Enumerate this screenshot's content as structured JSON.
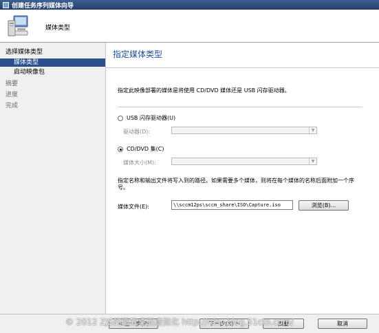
{
  "window": {
    "title": "创建任务序列媒体向导"
  },
  "header": {
    "title": "媒体类型"
  },
  "sidebar": {
    "items": [
      {
        "label": "选择媒体类型"
      },
      {
        "label": "媒体类型"
      },
      {
        "label": "启动映像包"
      },
      {
        "label": "摘要"
      },
      {
        "label": "进度"
      },
      {
        "label": "完成"
      }
    ]
  },
  "main": {
    "title": "指定媒体类型",
    "description": "指定此映像部署的媒体是将使用 CD/DVD 媒体还是 USB 闪存驱动器。",
    "usb_option": {
      "label": "USB 闪存驱动器(U)",
      "selected": false
    },
    "drive_label": "驱动器(D):",
    "drive_value": "",
    "cd_option": {
      "label": "CD/DVD 集(C)",
      "selected": true
    },
    "size_label": "媒体大小(M):",
    "size_value": "",
    "note": "指定名称和输出文件将写入到的路径。如果需要多个媒体，则将在每个媒体的名称后面附加一个序号。",
    "file_label": "媒体文件(E):",
    "file_value": "\\\\sccm12ps\\sccm_share\\ISO\\Capture.iso",
    "browse_label": "浏览(B)..."
  },
  "footer": {
    "prev_label": "< 上一步(P)",
    "next_label": "下一步(N) >",
    "summary_label": "摘要",
    "cancel_label": "取消"
  },
  "watermark": "© 2012 ZJS的微软桌面虚拟化 http://rdsv.blog.51cto.com/"
}
